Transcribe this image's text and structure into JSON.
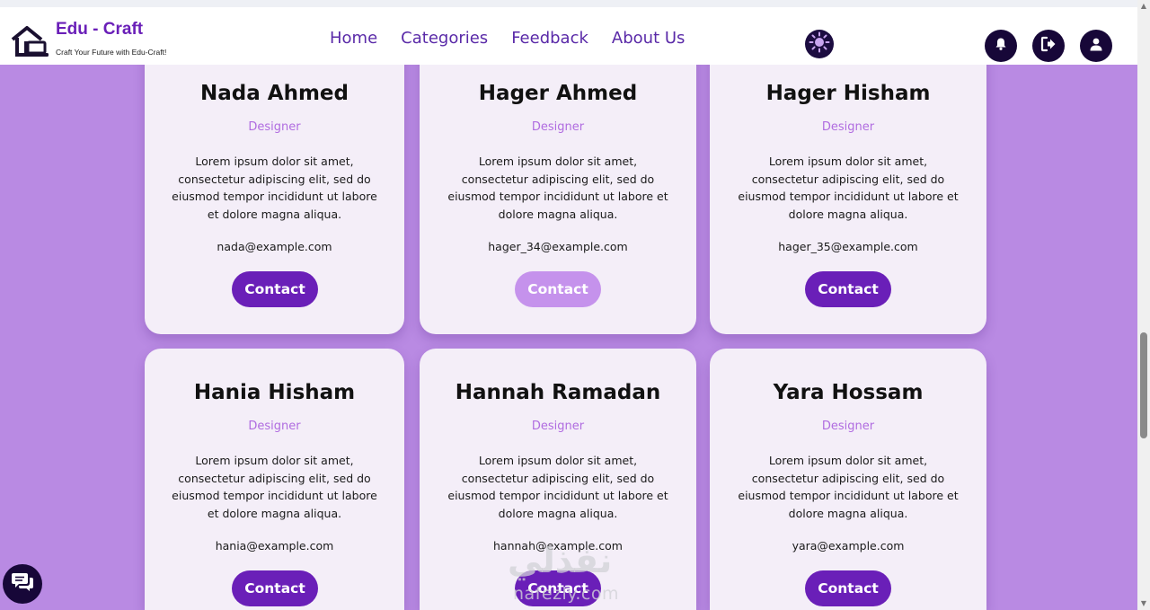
{
  "header": {
    "brand_title": "Edu - Craft",
    "brand_subtitle": "Craft Your Future with Edu-Craft!",
    "nav": [
      "Home",
      "Categories",
      "Feedback",
      "About Us"
    ]
  },
  "cards": [
    {
      "name": "Nada Ahmed",
      "role": "Designer",
      "bio": "Lorem ipsum dolor sit amet, consectetur adipiscing elit, sed do eiusmod tempor incididunt ut labore et dolore magna aliqua.",
      "email": "nada@example.com",
      "button": "Contact"
    },
    {
      "name": "Hager Ahmed",
      "role": "Designer",
      "bio": "Lorem ipsum dolor sit amet, consectetur adipiscing elit, sed do eiusmod tempor incididunt ut labore et dolore magna aliqua.",
      "email": "hager_34@example.com",
      "button": "Contact"
    },
    {
      "name": "Hager Hisham",
      "role": "Designer",
      "bio": "Lorem ipsum dolor sit amet, consectetur adipiscing elit, sed do eiusmod tempor incididunt ut labore et dolore magna aliqua.",
      "email": "hager_35@example.com",
      "button": "Contact"
    },
    {
      "name": "Hania Hisham",
      "role": "Designer",
      "bio": "Lorem ipsum dolor sit amet, consectetur adipiscing elit, sed do eiusmod tempor incididunt ut labore et dolore magna aliqua.",
      "email": "hania@example.com",
      "button": "Contact"
    },
    {
      "name": "Hannah Ramadan",
      "role": "Designer",
      "bio": "Lorem ipsum dolor sit amet, consectetur adipiscing elit, sed do eiusmod tempor incididunt ut labore et dolore magna aliqua.",
      "email": "hannah@example.com",
      "button": "Contact"
    },
    {
      "name": "Yara Hossam",
      "role": "Designer",
      "bio": "Lorem ipsum dolor sit amet, consectetur adipiscing elit, sed do eiusmod tempor incididunt ut labore et dolore magna aliqua.",
      "email": "yara@example.com",
      "button": "Contact"
    }
  ],
  "watermark": {
    "arabic": "نفذلي",
    "latin": "nafezly.com"
  },
  "icons": {
    "logo": "house-laptop-icon",
    "theme": "sun-icon",
    "notifications": "bell-icon",
    "logout": "logout-icon",
    "profile": "user-icon",
    "chat": "chat-icon"
  },
  "colors": {
    "page_background": "#b98ae3",
    "brand_purple": "#6a1fb8",
    "button_light": "#c592ec",
    "role_text": "#b06ce0",
    "card_background": "#f4eef8",
    "icon_dark": "#170738"
  }
}
